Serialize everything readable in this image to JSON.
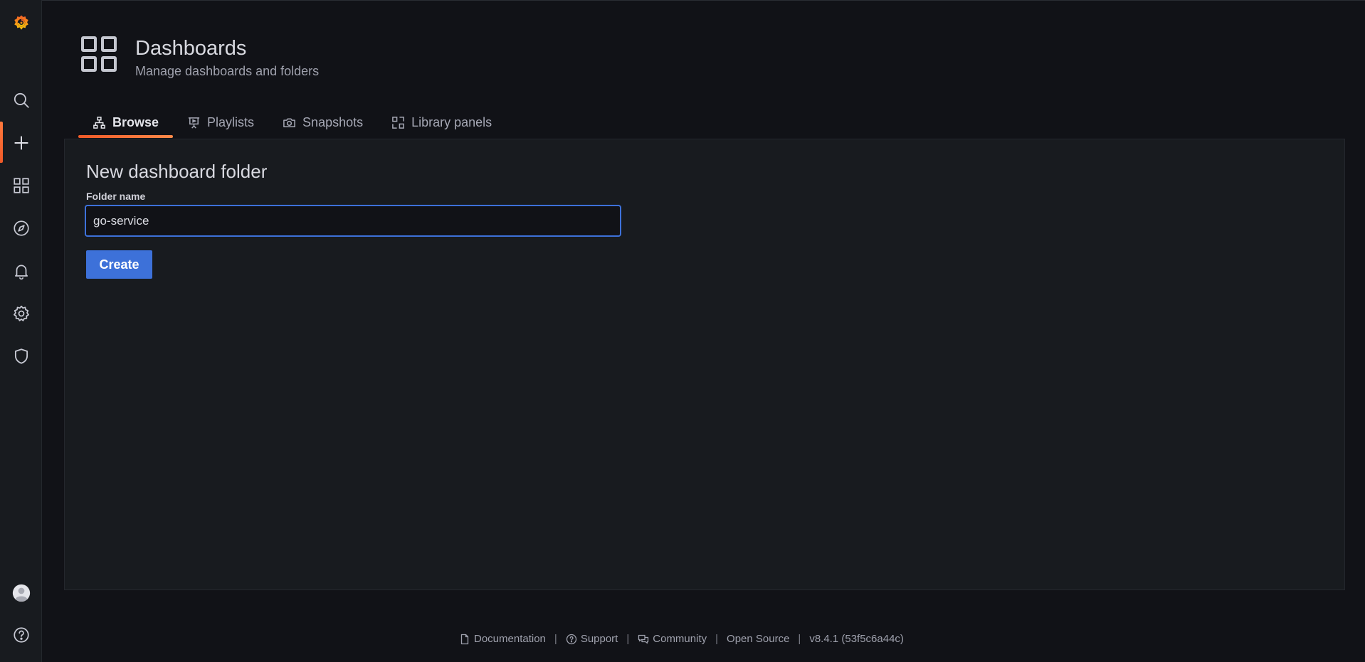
{
  "colors": {
    "background": "#111217",
    "sidebar": "#181b1f",
    "accent_orange": "#f05a28",
    "primary_blue": "#3d71d9"
  },
  "sidebar": {
    "logo": "grafana-logo-icon",
    "items": [
      {
        "icon": "search-icon",
        "active": false
      },
      {
        "icon": "plus-icon",
        "active": true
      },
      {
        "icon": "dashboards-icon",
        "active": false
      },
      {
        "icon": "compass-icon",
        "active": false
      },
      {
        "icon": "bell-icon",
        "active": false
      },
      {
        "icon": "gear-icon",
        "active": false
      },
      {
        "icon": "shield-icon",
        "active": false
      }
    ],
    "bottom": [
      {
        "icon": "avatar-icon"
      },
      {
        "icon": "help-icon"
      }
    ]
  },
  "header": {
    "title": "Dashboards",
    "subtitle": "Manage dashboards and folders"
  },
  "tabs": [
    {
      "label": "Browse",
      "icon": "sitemap-icon",
      "active": true
    },
    {
      "label": "Playlists",
      "icon": "presentation-icon",
      "active": false
    },
    {
      "label": "Snapshots",
      "icon": "camera-icon",
      "active": false
    },
    {
      "label": "Library panels",
      "icon": "library-panels-icon",
      "active": false
    }
  ],
  "form": {
    "title": "New dashboard folder",
    "field_label": "Folder name",
    "field_value": "go-service",
    "submit_label": "Create"
  },
  "footer": {
    "documentation": "Documentation",
    "support": "Support",
    "community": "Community",
    "open_source": "Open Source",
    "version": "v8.4.1 (53f5c6a44c)"
  }
}
